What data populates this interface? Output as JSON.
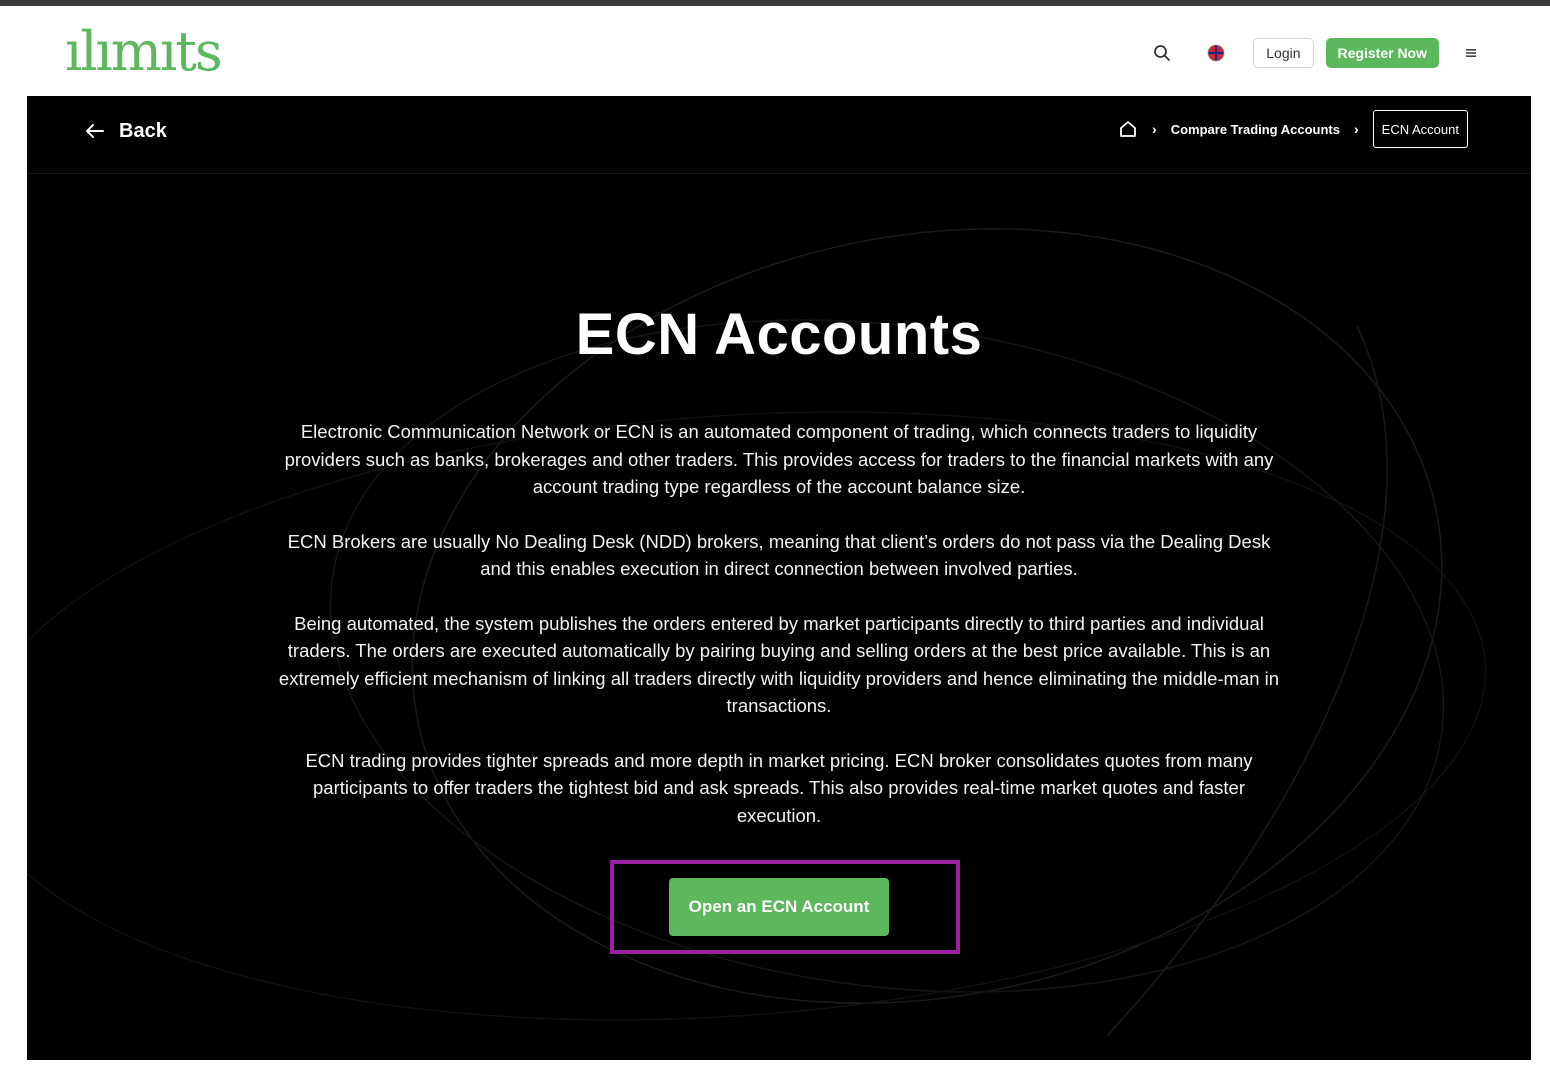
{
  "header": {
    "logo_text": "ılımıts",
    "login_label": "Login",
    "register_label": "Register Now"
  },
  "subnav": {
    "back_label": "Back",
    "breadcrumb": {
      "home_icon": "home-icon",
      "items": [
        "Compare Trading Accounts"
      ],
      "current": "ECN Account"
    }
  },
  "main": {
    "title": "ECN Accounts",
    "paragraphs": [
      "Electronic Communication Network or ECN is an automated component of trading, which connects traders to liquidity providers such as banks, brokerages and other traders. This provides access for traders to the financial markets with any account trading type regardless of the account balance size.",
      "ECN Brokers are usually No Dealing Desk (NDD) brokers, meaning that client’s orders do not pass via the Dealing Desk and this enables execution in direct connection between involved parties.",
      "Being automated, the system publishes the orders entered by market participants directly to third parties and individual traders. The orders are executed automatically by pairing buying and selling orders at the best price available. This is an extremely efficient mechanism of linking all traders directly with liquidity providers and hence eliminating the middle-man in transactions.",
      "ECN trading provides tighter spreads and more depth in market pricing. ECN broker consolidates quotes from many participants to offer traders the tightest bid and ask spreads. This also provides real-time market quotes and faster execution."
    ],
    "cta_label": "Open an ECN Account"
  },
  "colors": {
    "brand_green": "#5cb85c",
    "hero_bg": "#000000",
    "highlight_purple": "#9b1fa3"
  }
}
